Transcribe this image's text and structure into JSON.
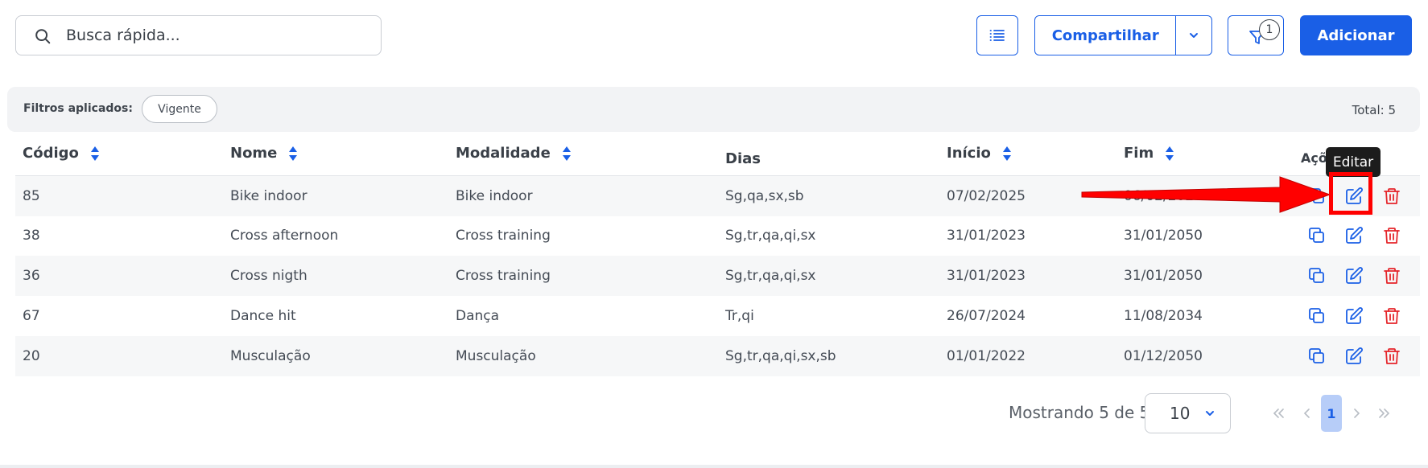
{
  "search": {
    "placeholder": "Busca rápida..."
  },
  "toolbar": {
    "share_label": "Compartilhar",
    "filter_badge": "1",
    "add_label": "Adicionar"
  },
  "filters": {
    "title": "Filtros aplicados:",
    "chips": [
      "Vigente"
    ],
    "total": "Total: 5"
  },
  "table": {
    "columns": [
      "Código",
      "Nome",
      "Modalidade",
      "Dias",
      "Início",
      "Fim",
      "Açõ"
    ],
    "rows": [
      [
        "85",
        "Bike indoor",
        "Bike indoor",
        "Sg,qa,sx,sb",
        "07/02/2025",
        "06/02/2026"
      ],
      [
        "38",
        "Cross afternoon",
        "Cross training",
        "Sg,tr,qa,qi,sx",
        "31/01/2023",
        "31/01/2050"
      ],
      [
        "36",
        "Cross nigth",
        "Cross training",
        "Sg,tr,qa,qi,sx",
        "31/01/2023",
        "31/01/2050"
      ],
      [
        "67",
        "Dance hit",
        "Dança",
        "Tr,qi",
        "26/07/2024",
        "11/08/2034"
      ],
      [
        "20",
        "Musculação",
        "Musculação",
        "Sg,tr,qa,qi,sx,sb",
        "01/01/2022",
        "01/12/2050"
      ]
    ]
  },
  "tooltip": "Editar",
  "pagination": {
    "showing": "Mostrando 5 de 5",
    "per_page": "10",
    "current_page": "1"
  },
  "colors": {
    "primary": "#1a5fe6",
    "danger": "#e5252a",
    "annotation": "#ff0000"
  }
}
